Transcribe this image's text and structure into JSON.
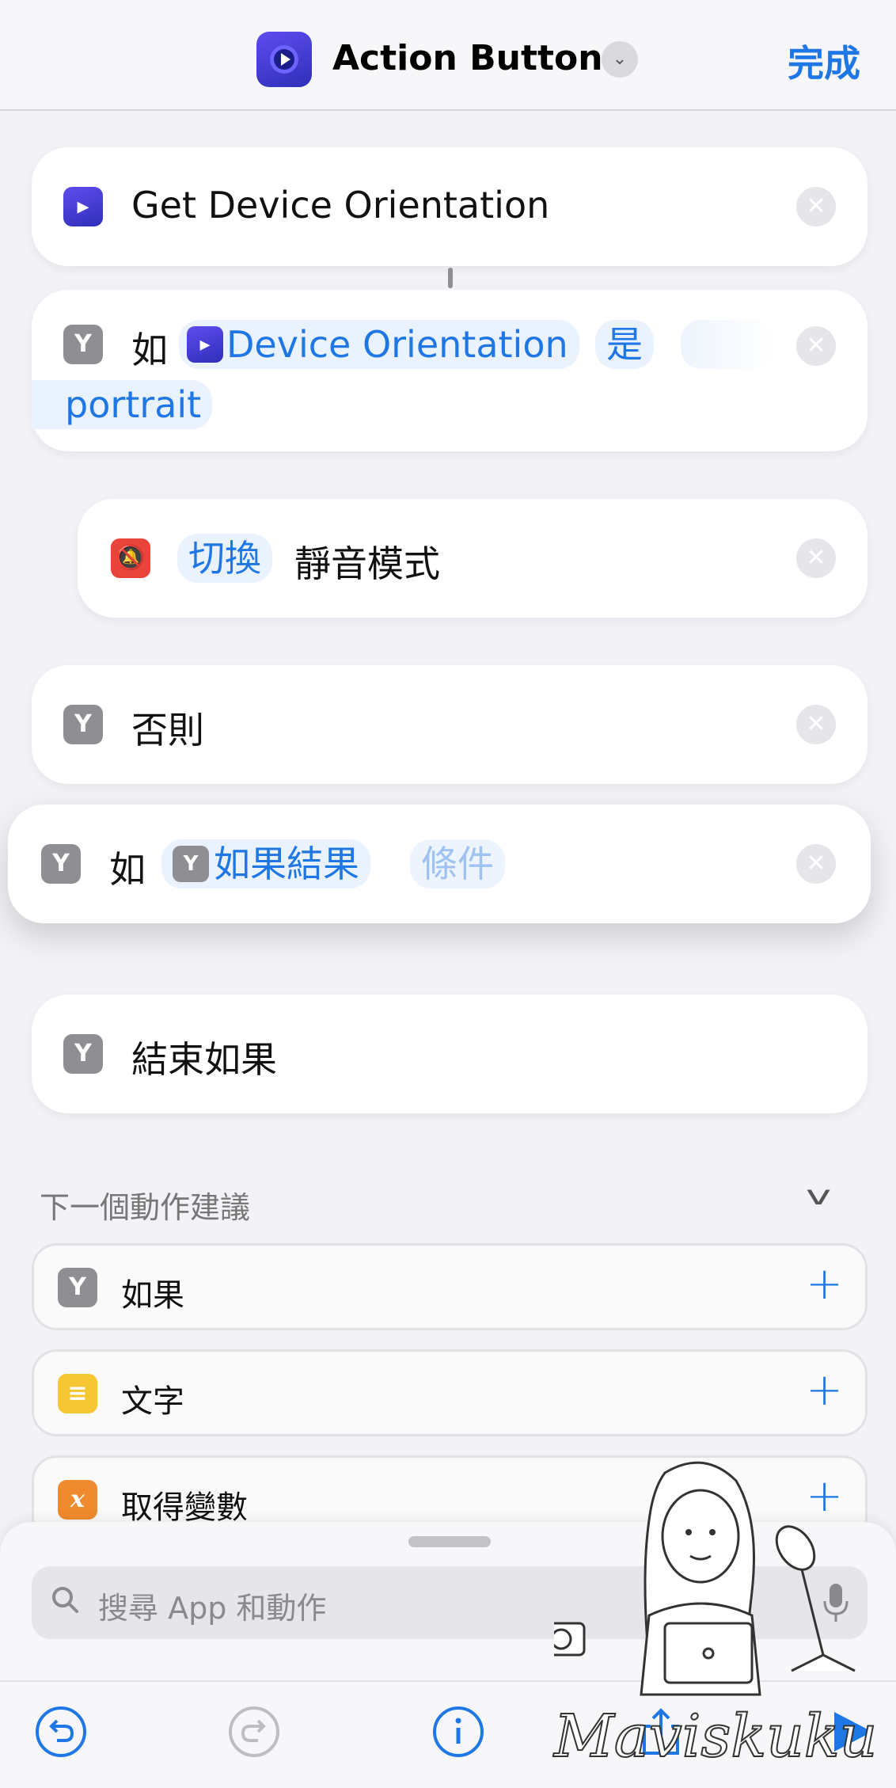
{
  "header": {
    "title": "Action Button",
    "done_label": "完成"
  },
  "actions": {
    "get_orientation": {
      "label": "Get Device Orientation"
    },
    "if_orientation": {
      "keyword": "如",
      "variable": "Device Orientation",
      "operator": "是",
      "value": "portrait"
    },
    "toggle_silent": {
      "verb": "切換",
      "label": "靜音模式"
    },
    "otherwise": {
      "label": "否則"
    },
    "if_result": {
      "keyword": "如",
      "variable": "如果結果",
      "condition_placeholder": "條件"
    },
    "end_if": {
      "label": "結束如果"
    }
  },
  "suggestions": {
    "header": "下一個動作建議",
    "items": [
      {
        "label": "如果",
        "icon": "branch-icon"
      },
      {
        "label": "文字",
        "icon": "text-icon"
      },
      {
        "label": "取得變數",
        "icon": "variable-icon",
        "icon_glyph": "x"
      }
    ]
  },
  "search": {
    "placeholder": "搜尋 App 和動作"
  },
  "watermark": {
    "signature": "Maviskuku"
  },
  "colors": {
    "accent": "#1f77e6",
    "token_bg": "#eaf2fd",
    "background": "#f2f2f7"
  }
}
